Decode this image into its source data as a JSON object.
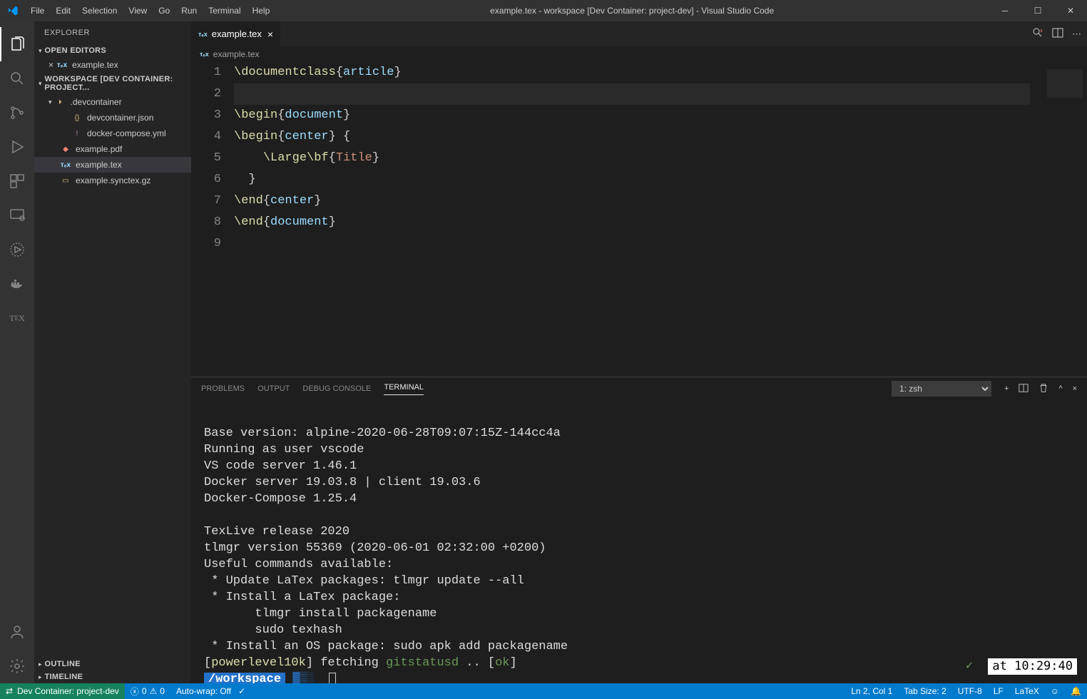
{
  "titlebar": {
    "menus": [
      "File",
      "Edit",
      "Selection",
      "View",
      "Go",
      "Run",
      "Terminal",
      "Help"
    ],
    "title": "example.tex - workspace [Dev Container: project-dev] - Visual Studio Code"
  },
  "sidebar": {
    "title": "EXPLORER",
    "open_editors": {
      "label": "OPEN EDITORS",
      "items": [
        {
          "name": "example.tex"
        }
      ]
    },
    "workspace": {
      "label": "WORKSPACE [DEV CONTAINER: PROJECT...",
      "folder": ".devcontainer",
      "folder_items": [
        "devcontainer.json",
        "docker-compose.yml"
      ],
      "files": [
        "example.pdf",
        "example.tex",
        "example.synctex.gz"
      ]
    },
    "outline": "OUTLINE",
    "timeline": "TIMELINE"
  },
  "tabs": {
    "active": "example.tex"
  },
  "breadcrumb": "example.tex",
  "code": {
    "lines": [
      "1",
      "2",
      "3",
      "4",
      "5",
      "6",
      "7",
      "8",
      "9"
    ],
    "l1_cmd": "\\documentclass",
    "l1_arg": "article",
    "l3_cmd": "\\begin",
    "l3_arg": "document",
    "l4_cmd": "\\begin",
    "l4_arg": "center",
    "l5_cmd1": "\\Large",
    "l5_cmd2": "\\bf",
    "l5_arg": "Title",
    "l7_cmd": "\\end",
    "l7_arg": "center",
    "l8_cmd": "\\end",
    "l8_arg": "document"
  },
  "panel": {
    "tabs": [
      "PROBLEMS",
      "OUTPUT",
      "DEBUG CONSOLE",
      "TERMINAL"
    ],
    "active": "TERMINAL",
    "select": "1: zsh"
  },
  "terminal": {
    "l1": "Base version: alpine-2020-06-28T09:07:15Z-144cc4a",
    "l2": "Running as user vscode",
    "l3": "VS code server 1.46.1",
    "l4": "Docker server 19.03.8 | client 19.03.6",
    "l5": "Docker-Compose 1.25.4",
    "l6": "",
    "l7": "TexLive release 2020",
    "l8": "tlmgr version 55369 (2020-06-01 02:32:00 +0200)",
    "l9": "Useful commands available:",
    "l10": " * Update LaTex packages: tlmgr update --all",
    "l11": " * Install a LaTex package:",
    "l12": "       tlmgr install packagename",
    "l13": "       sudo texhash",
    "l14": " * Install an OS package: sudo apk add packagename",
    "p_pl10k": "powerlevel10k",
    "p_fetch": " fetching ",
    "p_git": "gitstatusd",
    "p_dots": " .. ",
    "p_ok": "ok",
    "prompt_path": "/workspace",
    "time": "at 10:29:40"
  },
  "statusbar": {
    "remote": "Dev Container: project-dev",
    "errors": "0",
    "warnings": "0",
    "autowrap": "Auto-wrap: Off",
    "ln": "Ln 2, Col 1",
    "tab": "Tab Size: 2",
    "enc": "UTF-8",
    "eol": "LF",
    "lang": "LaTeX"
  }
}
